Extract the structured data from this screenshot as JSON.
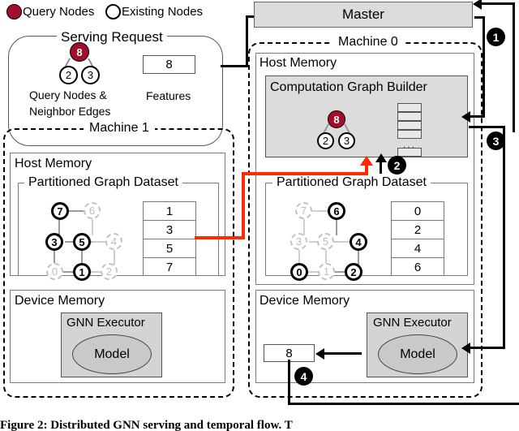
{
  "legend": {
    "query_nodes_label": "Query Nodes",
    "existing_nodes_label": "Existing Nodes",
    "query_color": "#A00F2B",
    "existing_color": "#FFFFFF"
  },
  "serving_request": {
    "title": "Serving Request",
    "graph": {
      "query_node": "8",
      "neighbors": [
        "2",
        "3"
      ]
    },
    "graph_caption_line1": "Query Nodes &",
    "graph_caption_line2": "Neighbor Edges",
    "features_value": "8",
    "features_label": "Features"
  },
  "master": {
    "label": "Master"
  },
  "machine0": {
    "title": "Machine 0",
    "host_memory_label": "Host Memory",
    "builder": {
      "title": "Computation Graph Builder",
      "query_node": "8",
      "neighbors": [
        "2",
        "3"
      ],
      "stack_rows": [
        "",
        "",
        "",
        ""
      ],
      "stack_ellipsis": "...",
      "stack_last_row": ""
    },
    "dataset": {
      "title": "Partitioned Graph Dataset",
      "active_nodes": [
        "0",
        "2",
        "4",
        "6"
      ],
      "inactive_nodes": [
        "1",
        "3",
        "5",
        "7"
      ],
      "id_table": [
        "0",
        "2",
        "4",
        "6"
      ]
    },
    "device_memory_label": "Device Memory",
    "executor": {
      "title": "GNN Executor",
      "model_label": "Model"
    },
    "result_value": "8"
  },
  "machine1": {
    "title": "Machine 1",
    "host_memory_label": "Host Memory",
    "dataset": {
      "title": "Partitioned Graph Dataset",
      "active_nodes": [
        "1",
        "3",
        "5",
        "7"
      ],
      "inactive_nodes": [
        "0",
        "2",
        "4",
        "6"
      ],
      "id_table": [
        "1",
        "3",
        "5",
        "7"
      ]
    },
    "device_memory_label": "Device Memory",
    "executor": {
      "title": "GNN Executor",
      "model_label": "Model"
    }
  },
  "steps": {
    "step1": "❶",
    "step2": "❷",
    "step3": "❸",
    "step4": "❹",
    "one": "1",
    "two": "2",
    "three": "3",
    "four": "4"
  },
  "caption": {
    "text": "Figure 2: Distributed GNN serving and temporal flow. T"
  },
  "colors": {
    "accent_red": "#FF2A00",
    "query_crimson": "#A00F2B",
    "grey_fill": "#DCDCDC"
  }
}
